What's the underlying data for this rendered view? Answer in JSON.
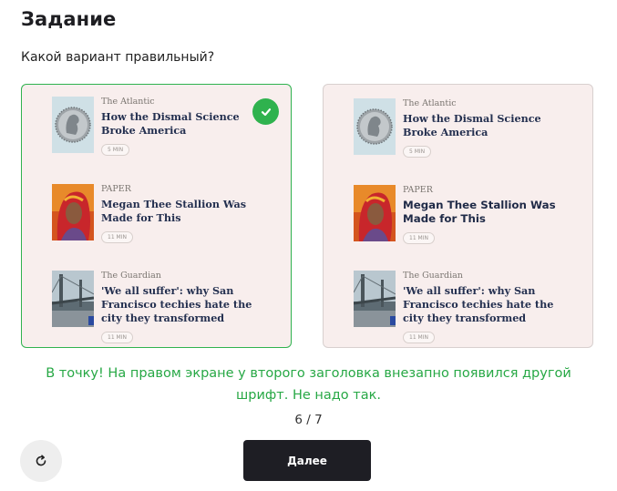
{
  "page": {
    "title": "Задание",
    "question": "Какой вариант правильный?",
    "feedback": "В точку! На правом экране у второго заголовка внезапно появился другой шрифт. Не надо так.",
    "counter": "6 / 7",
    "next_label": "Далее",
    "reset_icon": "refresh-icon"
  },
  "colors": {
    "correct": "#2fb24e",
    "card_bg": "#f8eeed",
    "headline": "#243050",
    "button": "#1e1e24"
  },
  "options": [
    {
      "selected": true,
      "check_icon": "checkmark-icon",
      "articles": [
        {
          "source": "The Atlantic",
          "headline": "How the Dismal Science Broke America",
          "time": "5 MIN",
          "thumb_icon": "coin-image"
        },
        {
          "source": "PAPER",
          "headline": "Megan Thee Stallion Was Made for This",
          "time": "11 MIN",
          "thumb_icon": "portrait-image"
        },
        {
          "source": "The Guardian",
          "headline": "'We all suffer': why San Francisco techies hate the city they transformed",
          "time": "11 MIN",
          "thumb_icon": "bridge-image"
        }
      ]
    },
    {
      "selected": false,
      "articles": [
        {
          "source": "The Atlantic",
          "headline": "How the Dismal Science Broke America",
          "time": "5 MIN",
          "thumb_icon": "coin-image"
        },
        {
          "source": "PAPER",
          "headline": "Megan Thee Stallion Was Made for This",
          "time": "11 MIN",
          "thumb_icon": "portrait-image"
        },
        {
          "source": "The Guardian",
          "headline": "'We all suffer': why San Francisco techies hate the city they transformed",
          "time": "11 MIN",
          "thumb_icon": "bridge-image"
        }
      ]
    }
  ]
}
